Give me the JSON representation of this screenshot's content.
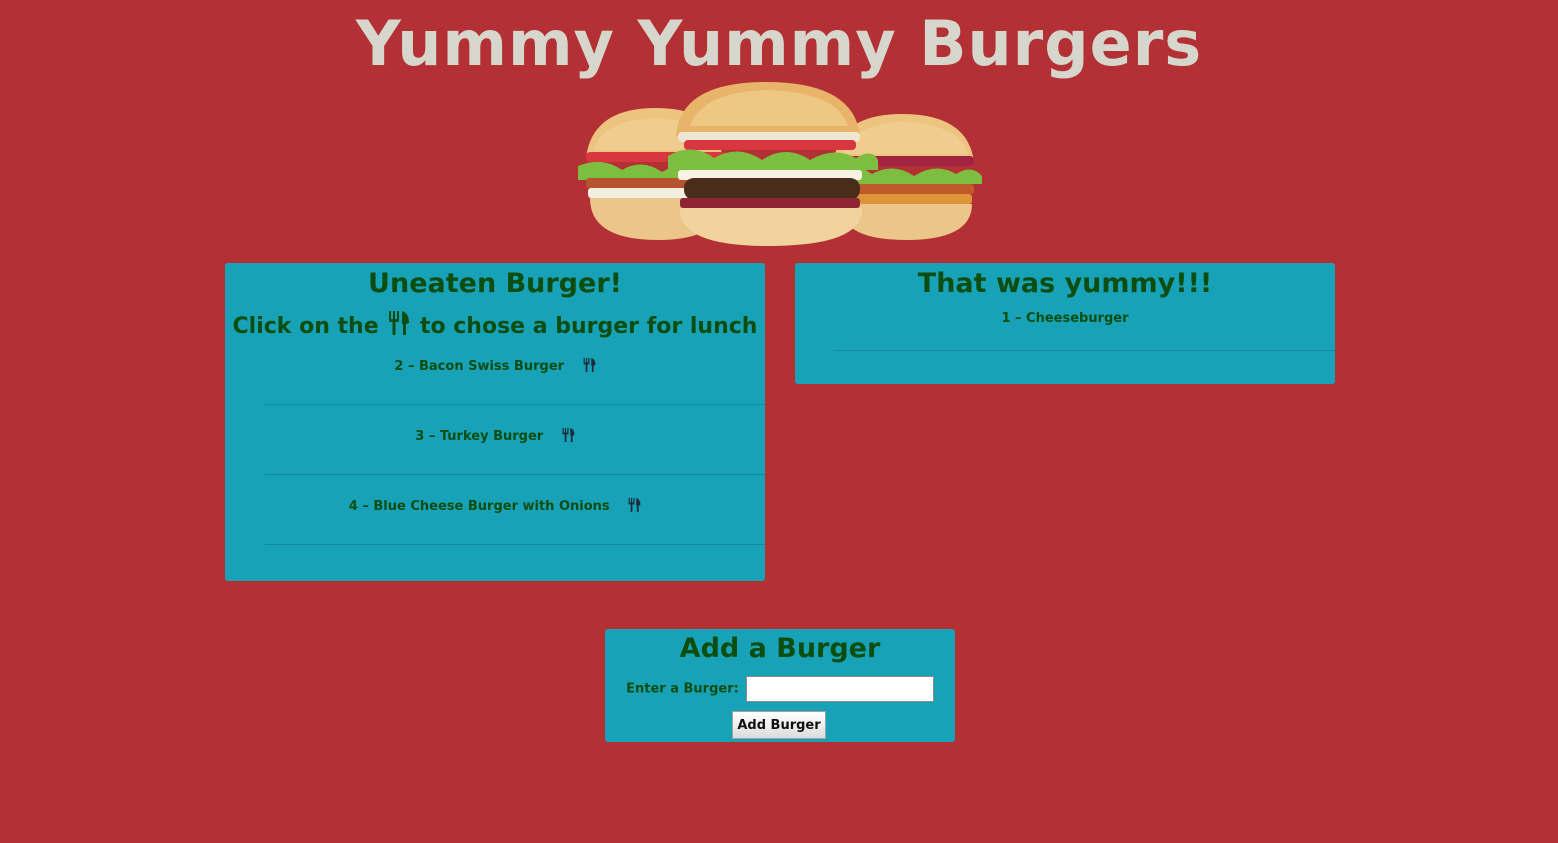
{
  "header": {
    "title": "Yummy Yummy Burgers",
    "hero_image": "three-burgers-illustration"
  },
  "uneaten_panel": {
    "heading": "Uneaten Burger!",
    "instruction_before": "Click on the",
    "instruction_icon": "fork-knife-icon",
    "instruction_after": "to chose a burger for lunch",
    "items": [
      {
        "label": "2 – Bacon Swiss Burger",
        "icon": "fork-knife-icon"
      },
      {
        "label": "3 – Turkey Burger",
        "icon": "fork-knife-icon"
      },
      {
        "label": "4 – Blue Cheese Burger with Onions",
        "icon": "fork-knife-icon"
      }
    ]
  },
  "eaten_panel": {
    "heading": "That was yummy!!!",
    "items": [
      {
        "label": "1 – Cheeseburger"
      }
    ]
  },
  "add_panel": {
    "heading": "Add a Burger",
    "input_label": "Enter a Burger:",
    "input_value": "",
    "button_label": "Add Burger"
  },
  "colors": {
    "background": "#b33134",
    "panel": "#17a2b8",
    "heading_text": "#0e4d10",
    "title_text": "#d6d6cc"
  }
}
